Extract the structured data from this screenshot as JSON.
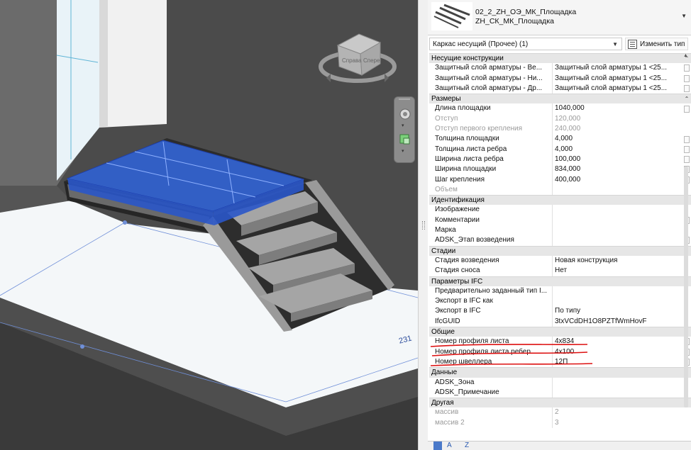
{
  "viewport": {
    "viewcube_labels": {
      "right": "Справа",
      "front": "Спере"
    },
    "dimension_text": "231",
    "colors": {
      "wall": "#4a4a4a",
      "floor": "#f2f5f7",
      "selection": "#2f5fd8",
      "steel": "#555555"
    }
  },
  "properties": {
    "type_name_line1": "02_2_ZH_ОЭ_МК_Площадка",
    "type_name_line2": "ZH_СК_МК_Площадка",
    "selector": "Каркас несущий (Прочее) (1)",
    "edit_type": "Изменить тип",
    "groups": [
      {
        "name": "Несущие конструкции",
        "rows": [
          {
            "name": "Защитный слой арматуры - Ве...",
            "value": "Защитный слой арматуры 1 <25..."
          },
          {
            "name": "Защитный слой арматуры - Ни...",
            "value": "Защитный слой арматуры 1 <25..."
          },
          {
            "name": "Защитный слой арматуры - Др...",
            "value": "Защитный слой арматуры 1 <25..."
          }
        ]
      },
      {
        "name": "Размеры",
        "rows": [
          {
            "name": "Длина площадки",
            "value": "1040,000"
          },
          {
            "name": "Отступ",
            "value": "120,000"
          },
          {
            "name": "Отступ первого крепления",
            "value": "240,000"
          },
          {
            "name": "Толщина площадки",
            "value": "4,000"
          },
          {
            "name": "Толщина листа ребра",
            "value": "4,000"
          },
          {
            "name": "Ширина листа ребра",
            "value": "100,000"
          },
          {
            "name": "Ширина площадки",
            "value": "834,000"
          },
          {
            "name": "Шаг крепления",
            "value": "400,000"
          },
          {
            "name": "Объем",
            "value": ""
          }
        ]
      },
      {
        "name": "Идентификация",
        "rows": [
          {
            "name": "Изображение",
            "value": ""
          },
          {
            "name": "Комментарии",
            "value": ""
          },
          {
            "name": "Марка",
            "value": ""
          },
          {
            "name": "ADSK_Этап возведения",
            "value": ""
          }
        ]
      },
      {
        "name": "Стадии",
        "rows": [
          {
            "name": "Стадия возведения",
            "value": "Новая конструкция"
          },
          {
            "name": "Стадия сноса",
            "value": "Нет"
          }
        ]
      },
      {
        "name": "Параметры IFC",
        "rows": [
          {
            "name": "Предварительно заданный тип I...",
            "value": ""
          },
          {
            "name": "Экспорт в IFC как",
            "value": ""
          },
          {
            "name": "Экспорт в IFC",
            "value": "По типу"
          },
          {
            "name": "IfcGUID",
            "value": "3txVCdDH1O8PZTfWmHovF"
          }
        ]
      },
      {
        "name": "Общие",
        "rows": [
          {
            "name": "Номер профиля листа",
            "value": "4x834"
          },
          {
            "name": "Номер профиля листа ребер",
            "value": "4x100"
          },
          {
            "name": "Номер швеллера",
            "value": "12П"
          }
        ]
      },
      {
        "name": "Данные",
        "rows": [
          {
            "name": "ADSK_Зона",
            "value": ""
          },
          {
            "name": "ADSK_Примечание",
            "value": ""
          }
        ]
      },
      {
        "name": "Другая",
        "rows": [
          {
            "name": "массив",
            "value": "2"
          },
          {
            "name": "массив 2",
            "value": "3"
          }
        ]
      }
    ],
    "bottom_labels": [
      "A",
      "Z"
    ]
  }
}
